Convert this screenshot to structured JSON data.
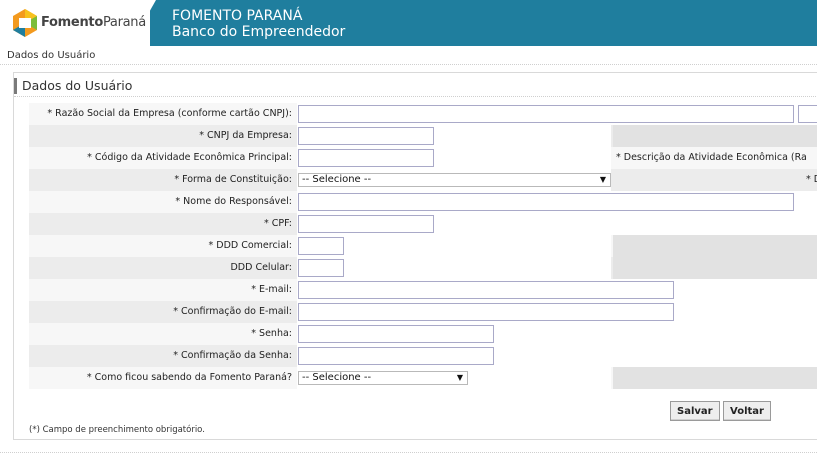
{
  "header": {
    "logo_text_bold": "Fomento",
    "logo_text_rest": "Paraná",
    "title_line1": "FOMENTO PARANÁ",
    "title_line2": "Banco do Empreendedor"
  },
  "breadcrumb": "Dados do Usuário",
  "section_title": "Dados do Usuário",
  "fields": {
    "razao_social": {
      "label": "* Razão Social da Empresa (conforme cartão CNPJ):",
      "value": ""
    },
    "cnpj": {
      "label": "* CNPJ da Empresa:",
      "value": ""
    },
    "codigo_atividade": {
      "label": "* Código da Atividade Econômica Principal:",
      "value": "",
      "right_label": "* Descrição da Atividade Econômica (Ra"
    },
    "forma_constituicao": {
      "label": "* Forma de Constituição:",
      "value": "-- Selecione --",
      "right_label": "* Dat"
    },
    "nome_responsavel": {
      "label": "* Nome do Responsável:",
      "value": ""
    },
    "cpf": {
      "label": "* CPF:",
      "value": ""
    },
    "ddd_comercial": {
      "label": "* DDD Comercial:",
      "value": ""
    },
    "ddd_celular": {
      "label": "DDD Celular:",
      "value": ""
    },
    "email": {
      "label": "* E-mail:",
      "value": ""
    },
    "confirm_email": {
      "label": "* Confirmação do E-mail:",
      "value": ""
    },
    "senha": {
      "label": "* Senha:",
      "value": ""
    },
    "confirm_senha": {
      "label": "* Confirmação da Senha:",
      "value": ""
    },
    "como_ficou_sabendo": {
      "label": "* Como ficou sabendo da Fomento Paraná?",
      "value": "-- Selecione --"
    }
  },
  "buttons": {
    "save": "Salvar",
    "back": "Voltar"
  },
  "footnote": "(*) Campo de preenchimento obrigatório.",
  "icons": {
    "select_arrow": "▼"
  },
  "colors": {
    "header": "#1f7e9e",
    "logo_orange": "#f39a1e",
    "logo_green": "#7bbd3a",
    "logo_blue": "#1f7e9e"
  }
}
